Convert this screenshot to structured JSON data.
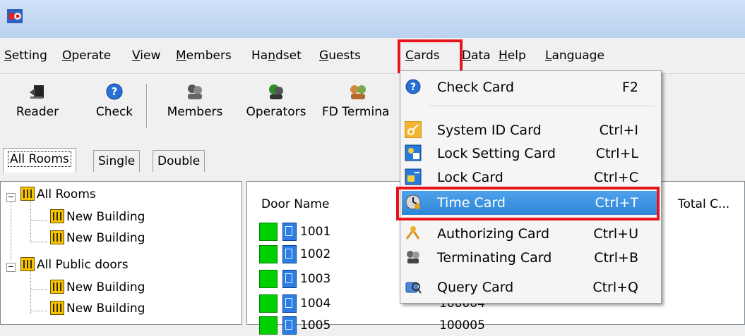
{
  "menubar": {
    "items": [
      {
        "label": "Setting",
        "u": "S",
        "rest": "etting"
      },
      {
        "label": "Operate",
        "u": "O",
        "rest": "perate"
      },
      {
        "label": "View",
        "u": "V",
        "rest": "iew"
      },
      {
        "label": "Members",
        "u": "M",
        "rest": "embers"
      },
      {
        "label": "Handset",
        "pre": "Ha",
        "u": "n",
        "rest": "dset"
      },
      {
        "label": "Guests",
        "u": "G",
        "rest": "uests"
      },
      {
        "label": "Cards",
        "u": "C",
        "rest": "ards"
      },
      {
        "label": "Data",
        "u": "D",
        "rest": "ata"
      },
      {
        "label": "Help",
        "u": "H",
        "rest": "elp"
      },
      {
        "label": "Language",
        "u": "L",
        "rest": "anguage"
      }
    ]
  },
  "toolbar": {
    "buttons": [
      {
        "label": "Reader",
        "icon": "card-reader-icon"
      },
      {
        "label": "Check",
        "icon": "help-icon"
      },
      {
        "label": "Members",
        "icon": "members-icon"
      },
      {
        "label": "Operators",
        "icon": "operators-icon"
      },
      {
        "label": "FD Termina",
        "icon": "fd-terminal-icon"
      }
    ]
  },
  "tabs": [
    "All Rooms",
    "Single",
    "Double"
  ],
  "tree": {
    "nodes": [
      {
        "label": "All Rooms",
        "level": 0
      },
      {
        "label": "New Building",
        "level": 1
      },
      {
        "label": "New Building",
        "level": 1
      },
      {
        "label": "All Public doors",
        "level": 0
      },
      {
        "label": "New Building",
        "level": 1
      },
      {
        "label": "New Building",
        "level": 1
      }
    ]
  },
  "list": {
    "columns": [
      "Door Name",
      "Total C..."
    ],
    "rows": [
      {
        "door": "1001",
        "card": ""
      },
      {
        "door": "1002",
        "card": ""
      },
      {
        "door": "1003",
        "card": ""
      },
      {
        "door": "1004",
        "card": "100004"
      },
      {
        "door": "1005",
        "card": "100005"
      }
    ]
  },
  "cards_menu": {
    "items": [
      {
        "label": "Check Card",
        "shortcut": "F2",
        "icon": "help-icon"
      },
      {
        "label": "System ID Card",
        "shortcut": "Ctrl+I",
        "icon": "key-icon"
      },
      {
        "label": "Lock Setting Card",
        "shortcut": "Ctrl+L",
        "icon": "lock-setting-icon"
      },
      {
        "label": "Lock Card",
        "shortcut": "Ctrl+C",
        "icon": "lock-card-icon"
      },
      {
        "label": "Time Card",
        "shortcut": "Ctrl+T",
        "icon": "clock-icon"
      },
      {
        "label": "Authorizing Card",
        "shortcut": "Ctrl+U",
        "icon": "authorizing-icon"
      },
      {
        "label": "Terminating Card",
        "shortcut": "Ctrl+B",
        "icon": "terminating-icon"
      },
      {
        "label": "Query Card",
        "shortcut": "Ctrl+Q",
        "icon": "query-icon"
      }
    ],
    "highlighted": "Time Card"
  },
  "colors": {
    "highlight": "#3a8fde",
    "callout": "#e8141c",
    "titlebar": "#c4d9f4"
  }
}
